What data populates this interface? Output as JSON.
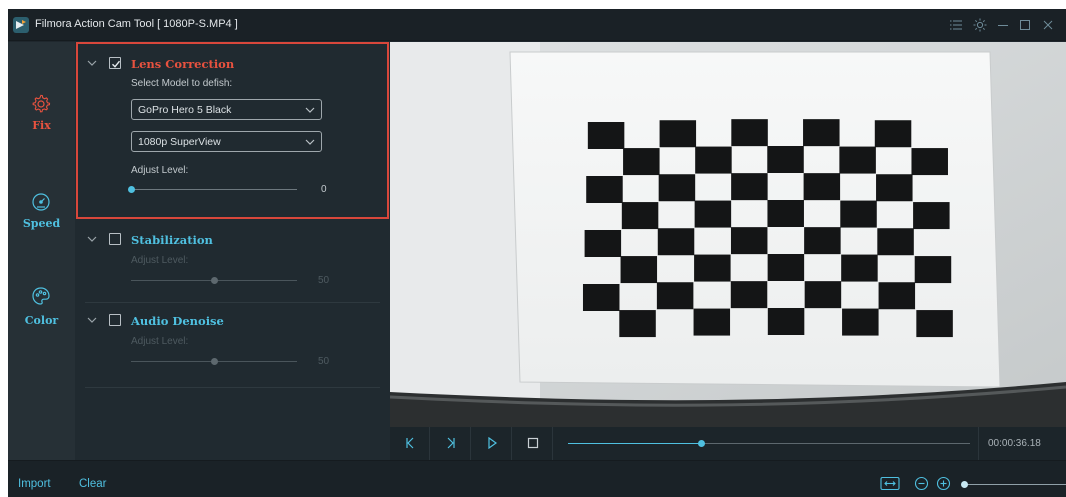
{
  "window": {
    "title": "Filmora Action Cam Tool  [ 1080P-S.MP4 ]",
    "controls": [
      "menu-icon",
      "brightness-icon",
      "minimize-icon",
      "maximize-icon",
      "close-icon"
    ]
  },
  "rail": {
    "items": [
      {
        "label": "Fix",
        "icon": "gear-icon",
        "active": true,
        "color": "#e8523f"
      },
      {
        "label": "Speed",
        "icon": "speedometer-icon",
        "active": false,
        "color": "#4fc0e0"
      },
      {
        "label": "Color",
        "icon": "palette-icon",
        "active": false,
        "color": "#4fc0e0"
      }
    ]
  },
  "panel": {
    "lens": {
      "title": "Lens Correction",
      "checked": true,
      "select_model_label": "Select Model to defish:",
      "model_value": "GoPro Hero 5 Black",
      "mode_value": "1080p SuperView",
      "adjust_label": "Adjust Level:",
      "level": 0,
      "level_text": "0"
    },
    "stabilization": {
      "title": "Stabilization",
      "checked": false,
      "adjust_label": "Adjust Level:",
      "level": 50,
      "level_text": "50"
    },
    "audio": {
      "title": "Audio Denoise",
      "checked": false,
      "adjust_label": "Adjust Level:",
      "level": 50,
      "level_text": "50"
    }
  },
  "playback": {
    "buttons": [
      "skip-to-start-icon",
      "step-frame-icon",
      "play-icon",
      "stop-icon"
    ],
    "progress": 0.33,
    "timecode": "00:00:36.18"
  },
  "bottom": {
    "import_label": "Import",
    "clear_label": "Clear",
    "zoom_level": 0.0
  },
  "colors": {
    "accent": "#4fc0e0",
    "active": "#e8523f",
    "highlight": "#d8473b",
    "text_primary": "#dbe1e4",
    "text_dim": "#8f999e",
    "text_disabled": "#4e5a60"
  }
}
